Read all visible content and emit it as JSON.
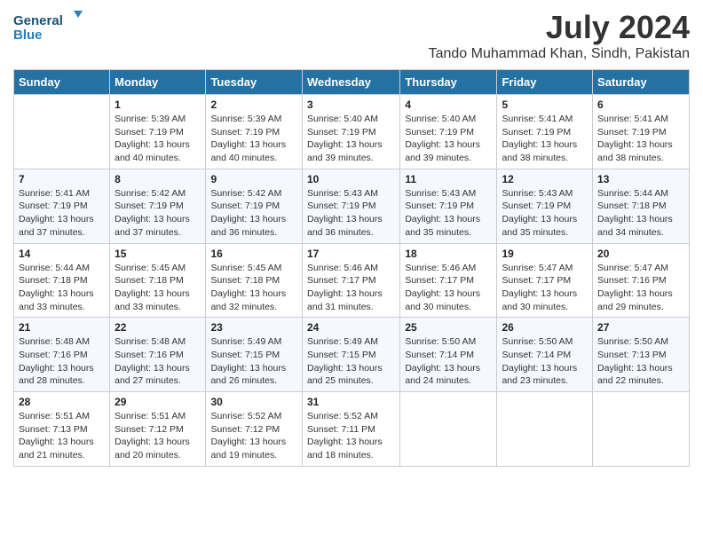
{
  "header": {
    "logo_general": "General",
    "logo_blue": "Blue",
    "month_year": "July 2024",
    "location": "Tando Muhammad Khan, Sindh, Pakistan"
  },
  "weekdays": [
    "Sunday",
    "Monday",
    "Tuesday",
    "Wednesday",
    "Thursday",
    "Friday",
    "Saturday"
  ],
  "weeks": [
    [
      {
        "day": "",
        "info": ""
      },
      {
        "day": "1",
        "info": "Sunrise: 5:39 AM\nSunset: 7:19 PM\nDaylight: 13 hours\nand 40 minutes."
      },
      {
        "day": "2",
        "info": "Sunrise: 5:39 AM\nSunset: 7:19 PM\nDaylight: 13 hours\nand 40 minutes."
      },
      {
        "day": "3",
        "info": "Sunrise: 5:40 AM\nSunset: 7:19 PM\nDaylight: 13 hours\nand 39 minutes."
      },
      {
        "day": "4",
        "info": "Sunrise: 5:40 AM\nSunset: 7:19 PM\nDaylight: 13 hours\nand 39 minutes."
      },
      {
        "day": "5",
        "info": "Sunrise: 5:41 AM\nSunset: 7:19 PM\nDaylight: 13 hours\nand 38 minutes."
      },
      {
        "day": "6",
        "info": "Sunrise: 5:41 AM\nSunset: 7:19 PM\nDaylight: 13 hours\nand 38 minutes."
      }
    ],
    [
      {
        "day": "7",
        "info": "Sunrise: 5:41 AM\nSunset: 7:19 PM\nDaylight: 13 hours\nand 37 minutes."
      },
      {
        "day": "8",
        "info": "Sunrise: 5:42 AM\nSunset: 7:19 PM\nDaylight: 13 hours\nand 37 minutes."
      },
      {
        "day": "9",
        "info": "Sunrise: 5:42 AM\nSunset: 7:19 PM\nDaylight: 13 hours\nand 36 minutes."
      },
      {
        "day": "10",
        "info": "Sunrise: 5:43 AM\nSunset: 7:19 PM\nDaylight: 13 hours\nand 36 minutes."
      },
      {
        "day": "11",
        "info": "Sunrise: 5:43 AM\nSunset: 7:19 PM\nDaylight: 13 hours\nand 35 minutes."
      },
      {
        "day": "12",
        "info": "Sunrise: 5:43 AM\nSunset: 7:19 PM\nDaylight: 13 hours\nand 35 minutes."
      },
      {
        "day": "13",
        "info": "Sunrise: 5:44 AM\nSunset: 7:18 PM\nDaylight: 13 hours\nand 34 minutes."
      }
    ],
    [
      {
        "day": "14",
        "info": "Sunrise: 5:44 AM\nSunset: 7:18 PM\nDaylight: 13 hours\nand 33 minutes."
      },
      {
        "day": "15",
        "info": "Sunrise: 5:45 AM\nSunset: 7:18 PM\nDaylight: 13 hours\nand 33 minutes."
      },
      {
        "day": "16",
        "info": "Sunrise: 5:45 AM\nSunset: 7:18 PM\nDaylight: 13 hours\nand 32 minutes."
      },
      {
        "day": "17",
        "info": "Sunrise: 5:46 AM\nSunset: 7:17 PM\nDaylight: 13 hours\nand 31 minutes."
      },
      {
        "day": "18",
        "info": "Sunrise: 5:46 AM\nSunset: 7:17 PM\nDaylight: 13 hours\nand 30 minutes."
      },
      {
        "day": "19",
        "info": "Sunrise: 5:47 AM\nSunset: 7:17 PM\nDaylight: 13 hours\nand 30 minutes."
      },
      {
        "day": "20",
        "info": "Sunrise: 5:47 AM\nSunset: 7:16 PM\nDaylight: 13 hours\nand 29 minutes."
      }
    ],
    [
      {
        "day": "21",
        "info": "Sunrise: 5:48 AM\nSunset: 7:16 PM\nDaylight: 13 hours\nand 28 minutes."
      },
      {
        "day": "22",
        "info": "Sunrise: 5:48 AM\nSunset: 7:16 PM\nDaylight: 13 hours\nand 27 minutes."
      },
      {
        "day": "23",
        "info": "Sunrise: 5:49 AM\nSunset: 7:15 PM\nDaylight: 13 hours\nand 26 minutes."
      },
      {
        "day": "24",
        "info": "Sunrise: 5:49 AM\nSunset: 7:15 PM\nDaylight: 13 hours\nand 25 minutes."
      },
      {
        "day": "25",
        "info": "Sunrise: 5:50 AM\nSunset: 7:14 PM\nDaylight: 13 hours\nand 24 minutes."
      },
      {
        "day": "26",
        "info": "Sunrise: 5:50 AM\nSunset: 7:14 PM\nDaylight: 13 hours\nand 23 minutes."
      },
      {
        "day": "27",
        "info": "Sunrise: 5:50 AM\nSunset: 7:13 PM\nDaylight: 13 hours\nand 22 minutes."
      }
    ],
    [
      {
        "day": "28",
        "info": "Sunrise: 5:51 AM\nSunset: 7:13 PM\nDaylight: 13 hours\nand 21 minutes."
      },
      {
        "day": "29",
        "info": "Sunrise: 5:51 AM\nSunset: 7:12 PM\nDaylight: 13 hours\nand 20 minutes."
      },
      {
        "day": "30",
        "info": "Sunrise: 5:52 AM\nSunset: 7:12 PM\nDaylight: 13 hours\nand 19 minutes."
      },
      {
        "day": "31",
        "info": "Sunrise: 5:52 AM\nSunset: 7:11 PM\nDaylight: 13 hours\nand 18 minutes."
      },
      {
        "day": "",
        "info": ""
      },
      {
        "day": "",
        "info": ""
      },
      {
        "day": "",
        "info": ""
      }
    ]
  ]
}
